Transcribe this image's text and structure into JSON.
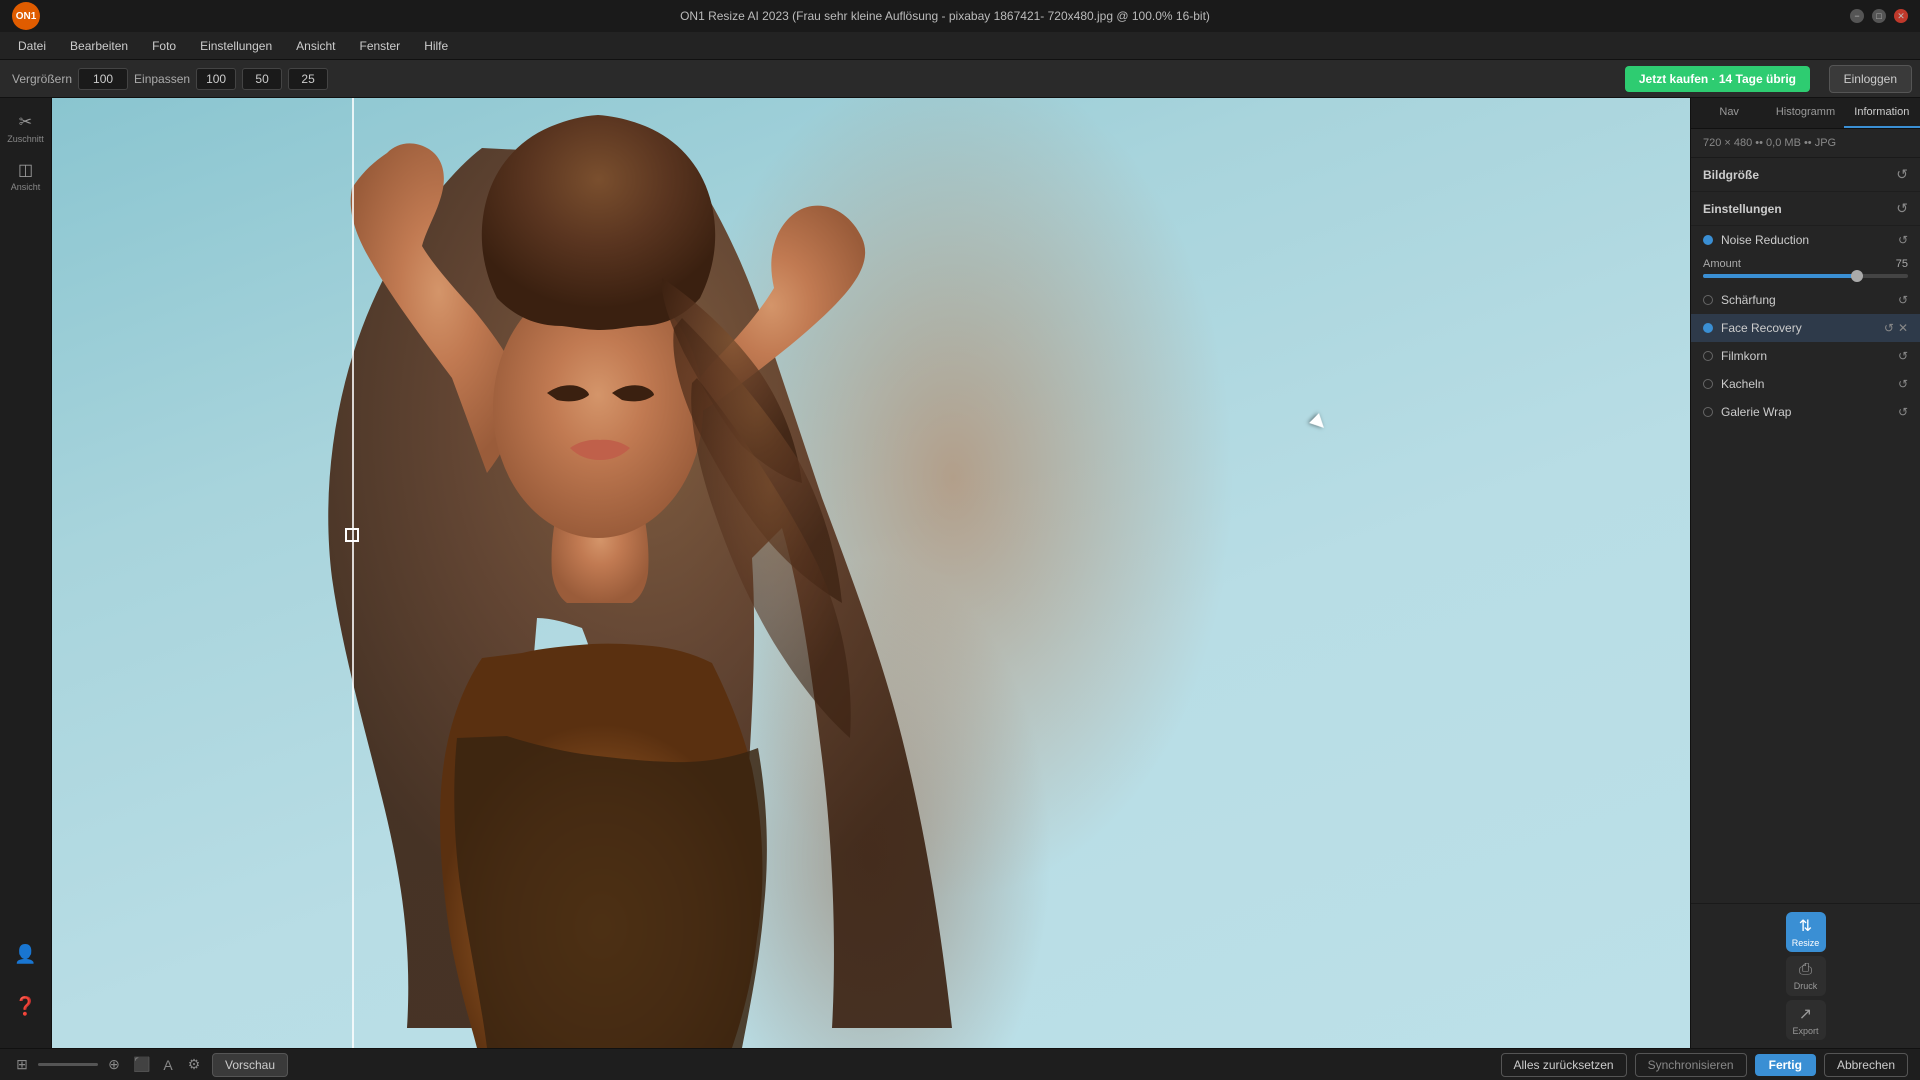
{
  "titlebar": {
    "title": "ON1 Resize AI 2023 (Frau sehr kleine Auflösung - pixabay 1867421- 720x480.jpg @ 100.0% 16-bit)",
    "min_label": "−",
    "max_label": "□",
    "close_label": "✕"
  },
  "menubar": {
    "items": [
      "Datei",
      "Bearbeiten",
      "Foto",
      "Einstellungen",
      "Ansicht",
      "Fenster",
      "Hilfe"
    ]
  },
  "toolbar": {
    "vergroessern_label": "Vergrößern",
    "vergroessern_value": "100",
    "einpassen_label": "Einpassen",
    "val1": "100",
    "val2": "50",
    "val3": "25",
    "buy_label": "Jetzt kaufen · 14 Tage übrig",
    "login_label": "Einloggen"
  },
  "left_sidebar": {
    "tools": [
      {
        "icon": "✂",
        "label": "Zuschnitt"
      },
      {
        "icon": "◫",
        "label": "Ansicht"
      }
    ]
  },
  "right_panel": {
    "tabs": [
      {
        "label": "Nav"
      },
      {
        "label": "Histogramm"
      },
      {
        "label": "Information"
      }
    ],
    "active_tab": "Information",
    "img_info": "720 × 480 •• 0,0 MB •• JPG",
    "sections": {
      "bildgroesse": {
        "title": "Bildgröße",
        "reset": "↺"
      },
      "einstellungen": {
        "title": "Einstellungen",
        "reset": "↺"
      }
    },
    "items": [
      {
        "dot": "blue",
        "label": "Noise Reduction",
        "reset": "↺",
        "hasClose": false
      },
      {
        "dot": "gray",
        "label": "Schärfung",
        "reset": "↺",
        "hasClose": false
      },
      {
        "dot": "blue",
        "label": "Face Recovery",
        "reset": "↺",
        "hasClose": true
      },
      {
        "dot": "gray",
        "label": "Filmkorn",
        "reset": "↺",
        "hasClose": false
      },
      {
        "dot": "gray",
        "label": "Kacheln",
        "reset": "↺",
        "hasClose": false
      },
      {
        "dot": "gray",
        "label": "Galerie Wrap",
        "reset": "↺",
        "hasClose": false
      }
    ],
    "slider": {
      "label": "Amount",
      "value": "75",
      "fill_pct": 75
    },
    "actions": [
      {
        "icon": "⇅",
        "label": "Resize",
        "active": true
      },
      {
        "icon": "⎙",
        "label": "Druck"
      },
      {
        "icon": "↗",
        "label": "Export"
      }
    ]
  },
  "bottom_bar": {
    "preview_label": "Vorschau",
    "reset_all_label": "Alles zurücksetzen",
    "sync_label": "Synchronisieren",
    "done_label": "Fertig",
    "cancel_label": "Abbrechen"
  }
}
